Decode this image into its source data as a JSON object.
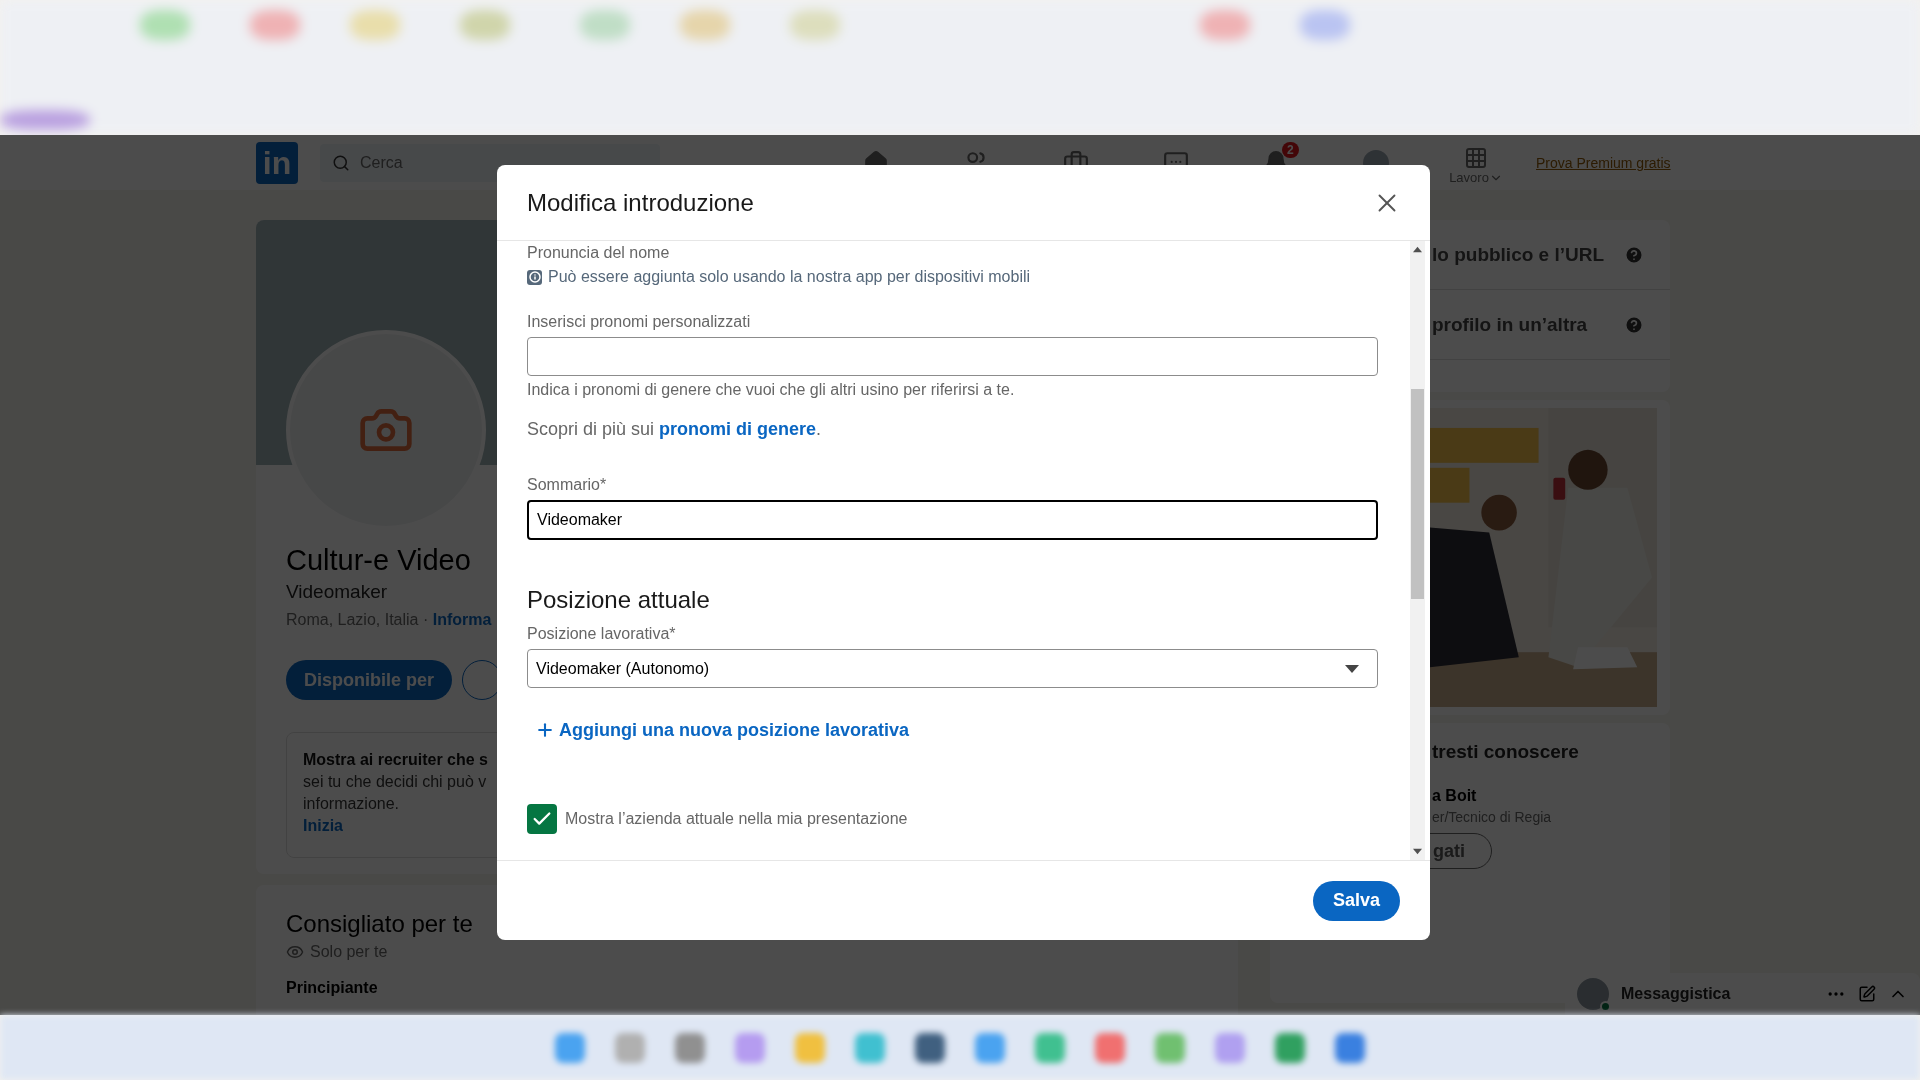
{
  "nav": {
    "logo": "in",
    "search": {
      "placeholder": "Cerca"
    },
    "notifications_badge": "2",
    "work_menu": "Lavoro",
    "premium_link": "Prova Premium gratis"
  },
  "profile": {
    "name": "Cultur-e Video",
    "headline": "Videomaker",
    "location": "Roma, Lazio, Italia · ",
    "contact_link": "Informa",
    "open_to_button": "Disponibile per",
    "recruiter_box": {
      "title": "Mostra ai recruiter che s",
      "lines": [
        "sei tu che decidi chi può v",
        "informazione."
      ],
      "link": "Inizia"
    }
  },
  "recommended": {
    "title": "Consigliato per te",
    "subtitle": "Solo per te",
    "section": "Principiante"
  },
  "sidebar": {
    "settings": [
      "lo pubblico e l’URL",
      "profilo in un’altra"
    ],
    "people": {
      "title": "tresti conoscere",
      "name": "a Boit",
      "headline": "er/Tecnico di Regia",
      "button": "gati"
    }
  },
  "messaging": {
    "label": "Messaggistica",
    "online": true
  },
  "modal": {
    "title": "Modifica introduzione",
    "pronunciation_label": "Pronuncia del nome",
    "pronunciation_note": "Può essere aggiunta solo usando la nostra app per dispositivi mobili",
    "pronouns": {
      "label": "Inserisci pronomi personalizzati",
      "hint": "Indica i pronomi di genere che vuoi che gli altri usino per riferirsi a te."
    },
    "learn_more": {
      "text": "Scopri di più sui ",
      "link": "pronomi di genere",
      "after": "."
    },
    "summary": {
      "label": "Sommario*",
      "value": "Videomaker",
      "focused": true
    },
    "position_heading": "Posizione attuale",
    "position": {
      "label": "Posizione lavorativa*",
      "value": "Videomaker (Autonomo)"
    },
    "add_position": "Aggiungi una nuova posizione lavorativa",
    "show_company": {
      "label": "Mostra l’azienda attuale nella mia presentazione",
      "checked": true
    },
    "save_button": "Salva"
  }
}
